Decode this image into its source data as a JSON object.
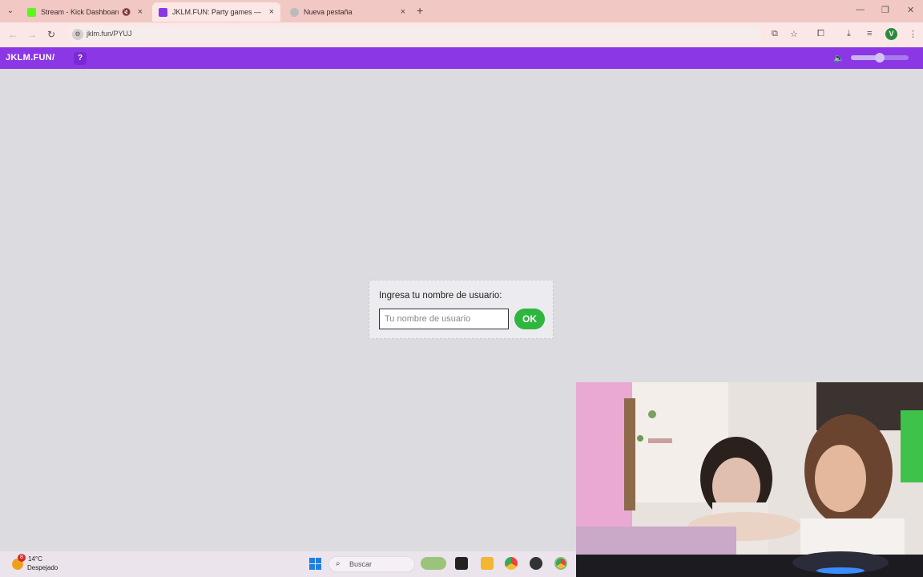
{
  "browser": {
    "tabs": [
      {
        "title": "Stream - Kick Dashboard",
        "active": false
      },
      {
        "title": "JKLM.FUN: Party games — PC &",
        "active": true
      },
      {
        "title": "Nueva pestaña",
        "active": false
      }
    ],
    "url": "jklm.fun/PYUJ",
    "profile_initial": "V"
  },
  "site": {
    "logo": "JKLM.FUN/",
    "help_label": "?",
    "volume_level": 0.5,
    "brand_color": "#8b37e6"
  },
  "dialog": {
    "prompt": "Ingresa tu nombre de usuario:",
    "input_value": "",
    "input_placeholder": "Tu nombre de usuario",
    "ok_label": "OK",
    "ok_color": "#2fb63f"
  },
  "taskbar": {
    "weather_badge": "8",
    "temperature": "14°C",
    "condition": "Despejado",
    "search_label": "Buscar"
  }
}
